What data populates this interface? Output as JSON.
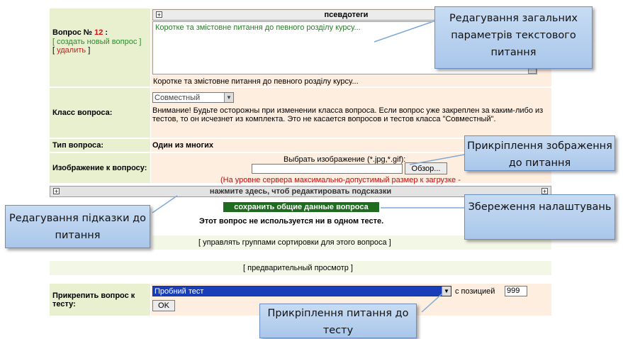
{
  "question": {
    "label_prefix": "Вопрос № ",
    "number": "12",
    "label_suffix": " :",
    "create_link": "[ создать новый вопрос ]",
    "delete_open": "[ ",
    "delete_link": "удалить",
    "delete_close": " ]",
    "editor_toolbar_title": "псевдотеги",
    "editor_text": "Коротке та змістовне питання до певного розділу курсу...",
    "preview_text": "Коротке та змістовне питання до певного розділу курсу..."
  },
  "class_row": {
    "label": "Класс вопроса:",
    "selected": "Совместный",
    "warning": "Внимание! Будьте осторожны при изменении класса вопроса. Если вопрос уже закреплен за каким-либо из тестов, то он исчезнет из комплекта. Это не касается вопросов и тестов класса \"Совместный\"."
  },
  "type_row": {
    "label": "Тип вопроса:",
    "value": "Один из многих"
  },
  "image_row": {
    "label": "Изображение к вопросу:",
    "choose_text": "Выбрать изображение (*.jpg,*.gif):",
    "browse_button": "Обзор...",
    "server_note": "(На уровне сервера максимально-допустимый размер к загрузке - "
  },
  "hints_bar": {
    "label": "нажмите здесь, чтоб редактировать подсказки"
  },
  "save": {
    "button": "сохранить общие данные вопроса",
    "not_used": "Этот вопрос не используется ни в одном тесте."
  },
  "links": {
    "manage_groups": "[ управлять группами сортировки для этого вопроса ]",
    "preview": "[ предварительный просмотр ]"
  },
  "attach": {
    "label": "Прикрепить вопрос к тесту:",
    "selected_test": "Пробний тест",
    "position_label": "с позицией",
    "position_value": "999",
    "ok": "OK"
  },
  "callouts": {
    "general": "Редагування загальних параметрів текстового питання",
    "image": "Прикріплення зображення до питання",
    "hint": "Редагування підказки до питання",
    "save": "Збереження налаштувань",
    "attach": "Прикріплення питання до тесту"
  },
  "colors": {
    "label_bg": "#e8f0cf",
    "cell_bg": "#fdeee0",
    "save_bg": "#1f6b1f",
    "select_highlight": "#1a3db8",
    "callout_bg": "#b8d1ef"
  }
}
